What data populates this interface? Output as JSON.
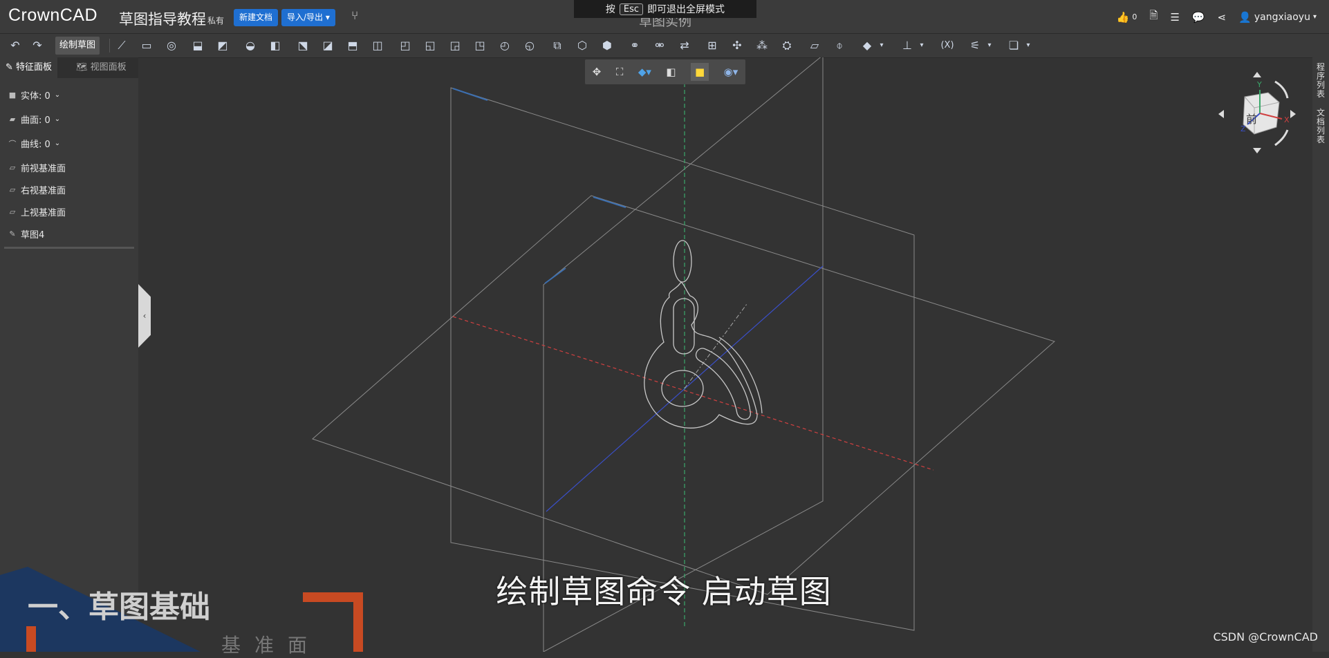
{
  "header": {
    "logo": "CrownCAD",
    "doc_title": "草图指导教程",
    "privacy": "私有",
    "new_doc": "新建文档",
    "import_export": "导入/导出",
    "like_count": "0",
    "user": "yangxiaoyu"
  },
  "fullscreen_notice": {
    "prefix": "按",
    "key": "Esc",
    "suffix": "即可退出全屏模式"
  },
  "model_title": "草图实例",
  "toolbar": {
    "sketch_label": "绘制草图",
    "variable_label": "(X)"
  },
  "left_panel": {
    "tabs": [
      "特征面板",
      "视图面板"
    ],
    "items": [
      {
        "label": "实体: 0",
        "icon": "solid-icon"
      },
      {
        "label": "曲面: 0",
        "icon": "surface-icon"
      },
      {
        "label": "曲线: 0",
        "icon": "curve-icon"
      },
      {
        "label": "前视基准面",
        "icon": "plane-icon"
      },
      {
        "label": "右视基准面",
        "icon": "plane-icon"
      },
      {
        "label": "上视基准面",
        "icon": "plane-icon"
      },
      {
        "label": "草图4",
        "icon": "sketch-icon"
      }
    ]
  },
  "right_strip": {
    "procedure_list": "程序列表",
    "doc_list": "文档列表"
  },
  "nav_cube": {
    "face_label": "前",
    "axis_x": "X",
    "axis_y": "Y",
    "axis_z": "Z"
  },
  "overlay": {
    "subtitle": "绘制草图命令 启动草图",
    "section_title": "一、草图基础",
    "section_sub": "基准面",
    "watermark": "CSDN @CrownCAD"
  },
  "colors": {
    "accent_blue": "#1f6fd1",
    "axis_red": "#d04040",
    "axis_blue": "#3a4fc8",
    "axis_green": "#3aa86a",
    "overlay_navy": "#1c3760",
    "overlay_orange": "#c84a22"
  }
}
